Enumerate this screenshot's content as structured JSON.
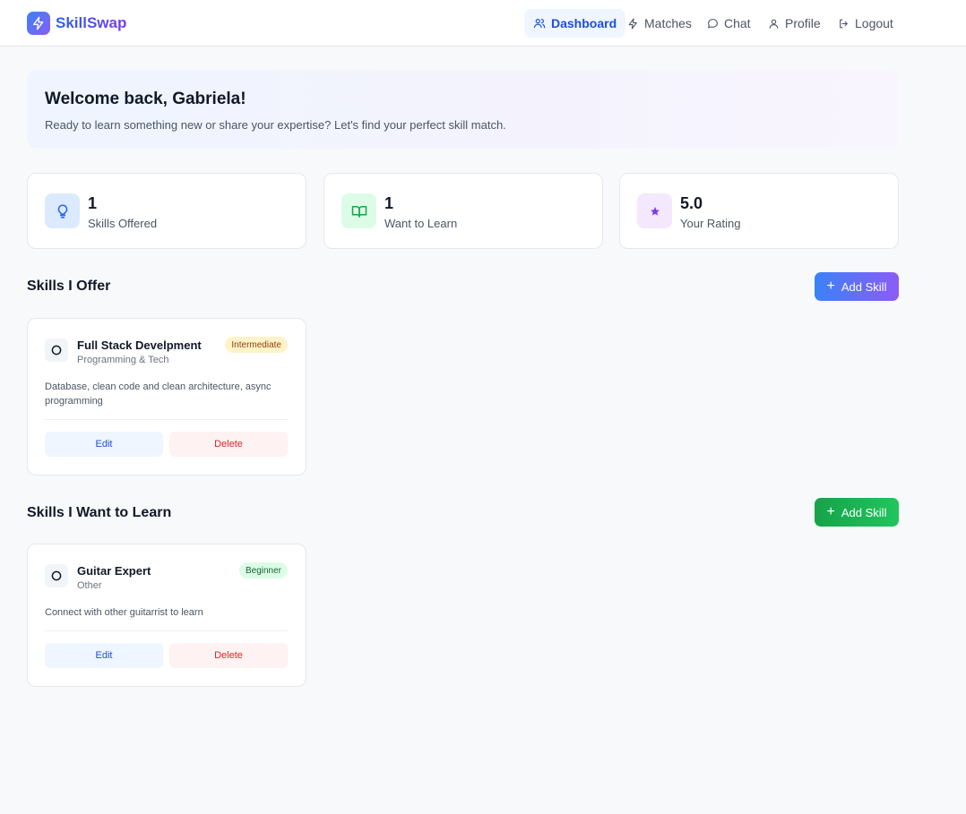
{
  "app": {
    "name": "SkillSwap"
  },
  "nav": {
    "items": [
      {
        "label": "Dashboard",
        "icon": "users-icon",
        "active": true
      },
      {
        "label": "Matches",
        "icon": "lightning-icon"
      },
      {
        "label": "Chat",
        "icon": "chat-bubble-icon"
      },
      {
        "label": "Profile",
        "icon": "user-icon"
      },
      {
        "label": "Logout",
        "icon": "logout-icon"
      }
    ]
  },
  "welcome": {
    "title": "Welcome back, Gabriela!",
    "subtitle": "Ready to learn something new or share your expertise? Let's find your perfect skill match."
  },
  "stats": [
    {
      "value": "1",
      "label": "Skills Offered",
      "icon": "lightbulb-icon",
      "color": "#2563eb",
      "bg": "#dbeafe"
    },
    {
      "value": "1",
      "label": "Want to Learn",
      "icon": "book-open-icon",
      "color": "#16a34a",
      "bg": "#dcfce7"
    },
    {
      "value": "5.0",
      "label": "Your Rating",
      "icon": "star-icon",
      "color": "#7c3aed",
      "bg": "#f3e8ff"
    }
  ],
  "offer": {
    "title": "Skills I Offer",
    "add_label": "Add Skill",
    "skills": [
      {
        "name": "Full Stack Develpment",
        "category": "Programming & Tech",
        "level": "Intermediate",
        "description": "Database, clean code and clean architecture, async programming",
        "edit_label": "Edit",
        "delete_label": "Delete"
      }
    ]
  },
  "learn": {
    "title": "Skills I Want to Learn",
    "add_label": "Add Skill",
    "skills": [
      {
        "name": "Guitar Expert",
        "category": "Other",
        "level": "Beginner",
        "description": "Connect with other guitarrist to learn",
        "edit_label": "Edit",
        "delete_label": "Delete"
      }
    ]
  }
}
